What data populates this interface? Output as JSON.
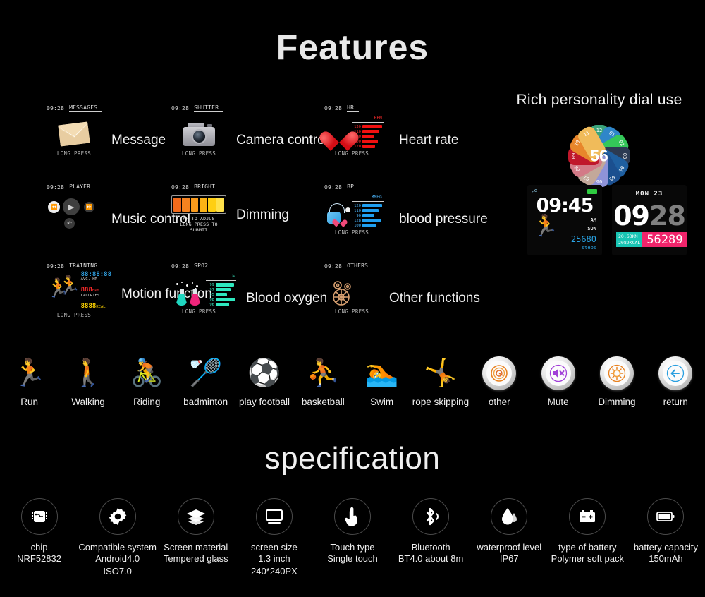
{
  "headings": {
    "features": "Features",
    "specification": "specification",
    "dial": "Rich personality dial use"
  },
  "features": [
    {
      "icon": "envelope-icon",
      "status_time": "09:28",
      "status_label": "MESSAGES",
      "hint": "LONG PRESS",
      "name": "Message"
    },
    {
      "icon": "camera-icon",
      "status_time": "09:28",
      "status_label": "SHUTTER",
      "hint": "LONG PRESS",
      "name": "Camera control"
    },
    {
      "icon": "heart-icon",
      "status_time": "09:28",
      "status_label": "HR",
      "hint": "LONG PRESS",
      "name": "Heart rate",
      "unit": "BPM",
      "bars": [
        {
          "value": "130",
          "pct": 96
        },
        {
          "value": "110",
          "pct": 80
        },
        {
          "value": "80",
          "pct": 56
        },
        {
          "value": "100",
          "pct": 72
        },
        {
          "value": "120",
          "pct": 60
        }
      ]
    },
    {
      "icon": "music-player-icon",
      "status_time": "09:28",
      "status_label": "PLAYER",
      "hint": "",
      "name": "Music control",
      "buttons": [
        "previous-track",
        "play",
        "next-track",
        "back"
      ]
    },
    {
      "icon": "brightness-bars-icon",
      "status_time": "09:28",
      "status_label": "BRIGHT",
      "hint": "",
      "name": "Dimming",
      "note_line1": "TAP TO ADJUST",
      "note_line2": "LONG PRESS TO SUBMIT",
      "segments": [
        "#f26a1b",
        "#f5821f",
        "#f99a1c",
        "#fcb315",
        "#ffcf12",
        "#ffe14a"
      ]
    },
    {
      "icon": "blood-pressure-cuff-icon",
      "status_time": "09:28",
      "status_label": "BP",
      "hint": "LONG PRESS",
      "name": "blood pressure",
      "unit": "MMHG",
      "bars": [
        {
          "value": "120",
          "pct": 92
        },
        {
          "value": "110",
          "pct": 74
        },
        {
          "value": "90",
          "pct": 56
        },
        {
          "value": "128",
          "pct": 86
        },
        {
          "value": "100",
          "pct": 64
        }
      ]
    },
    {
      "icon": "runners-icon",
      "status_time": "09:28",
      "status_label": "TRAINING",
      "hint": "LONG PRESS",
      "name": "Motion function",
      "training": {
        "duration": "88:88:88",
        "avg_hr_label": "AVG. HR",
        "avg_hr_value": "888",
        "avg_hr_unit": "BPM",
        "calories_label": "CALORIES",
        "calories_value": "8888",
        "calories_unit": "KCAL"
      }
    },
    {
      "icon": "flask-icon",
      "status_time": "09:28",
      "status_label": "SPO2",
      "hint": "LONG PRESS",
      "name": "Blood oxygen",
      "unit": "%",
      "bars": [
        {
          "value": "99",
          "pct": 88
        },
        {
          "value": "97",
          "pct": 70
        },
        {
          "value": "95",
          "pct": 54
        },
        {
          "value": "98",
          "pct": 96
        },
        {
          "value": "96",
          "pct": 62
        }
      ]
    },
    {
      "icon": "gears-icon",
      "status_time": "09:28",
      "status_label": "OTHERS",
      "hint": "LONG PRESS",
      "name": "Other functions"
    }
  ],
  "dial": {
    "center_value": "56",
    "petals": [
      {
        "label": "12",
        "color": "#3aa37a"
      },
      {
        "label": "01",
        "color": "#2f86c9"
      },
      {
        "label": "02",
        "color": "#34c759"
      },
      {
        "label": "03",
        "color": "#2c3a52"
      },
      {
        "label": "04",
        "color": "#1f5fa0"
      },
      {
        "label": "05",
        "color": "#1b4f8f"
      },
      {
        "label": "06",
        "color": "#8f93d8"
      },
      {
        "label": "07",
        "color": "#c3a89a"
      },
      {
        "label": "08",
        "color": "#d37a87"
      },
      {
        "label": "09",
        "color": "#c0172b"
      },
      {
        "label": "10",
        "color": "#e8862b"
      },
      {
        "label": "11",
        "color": "#f0bb5a"
      }
    ]
  },
  "watch_faces": [
    {
      "name": "steps-face",
      "time": "09:45",
      "meridiem": "AM",
      "weekday": "SUN",
      "steps": "25680",
      "steps_label": "steps"
    },
    {
      "name": "stats-face",
      "date": "MON 23",
      "hours": "09",
      "minutes": "28",
      "distance": "20.63KM",
      "calories": "2089KCAL",
      "steps": "56289"
    }
  ],
  "sports": [
    {
      "icon": "run-icon",
      "glyph": "🏃",
      "label": "Run",
      "type": "emoji"
    },
    {
      "icon": "walking-icon",
      "glyph": "🚶",
      "label": "Walking",
      "type": "emoji"
    },
    {
      "icon": "riding-icon",
      "glyph": "🚴",
      "label": "Riding",
      "type": "emoji"
    },
    {
      "icon": "badminton-icon",
      "glyph": "🏸",
      "label": "badminton",
      "type": "emoji"
    },
    {
      "icon": "football-icon",
      "glyph": "⚽",
      "label": "play football",
      "type": "emoji"
    },
    {
      "icon": "basketball-icon",
      "glyph": "⛹",
      "label": "basketball",
      "type": "emoji"
    },
    {
      "icon": "swim-icon",
      "glyph": "🏊",
      "label": "Swim",
      "type": "emoji"
    },
    {
      "icon": "rope-skipping-icon",
      "glyph": "🤸",
      "label": "rope skipping",
      "type": "emoji"
    },
    {
      "icon": "other-icon",
      "glyph": "",
      "label": "other",
      "type": "button",
      "color": "#e8811f"
    },
    {
      "icon": "mute-icon",
      "glyph": "",
      "label": "Mute",
      "type": "button",
      "color": "#a13fd8"
    },
    {
      "icon": "dimming-icon",
      "glyph": "",
      "label": "Dimming",
      "type": "button",
      "color": "#e8811f"
    },
    {
      "icon": "return-icon",
      "glyph": "",
      "label": "return",
      "type": "button",
      "color": "#2a9fe0"
    }
  ],
  "specs": [
    {
      "icon": "chip-icon",
      "name": "chip",
      "value": "NRF52832"
    },
    {
      "icon": "gear-icon",
      "name": "Compatible system",
      "value": "Android4.0\nISO7.0"
    },
    {
      "icon": "layers-icon",
      "name": "Screen material",
      "value": "Tempered glass"
    },
    {
      "icon": "monitor-icon",
      "name": "screen size",
      "value": "1.3 inch\n240*240PX"
    },
    {
      "icon": "touch-hand-icon",
      "name": "Touch type",
      "value": "Single touch"
    },
    {
      "icon": "bluetooth-icon",
      "name": "Bluetooth",
      "value": "BT4.0  about 8m"
    },
    {
      "icon": "water-drop-icon",
      "name": "waterproof level",
      "value": "IP67"
    },
    {
      "icon": "battery-cell-icon",
      "name": "type of battery",
      "value": "Polymer soft pack"
    },
    {
      "icon": "battery-capacity-icon",
      "name": "battery capacity",
      "value": "150mAh"
    }
  ]
}
